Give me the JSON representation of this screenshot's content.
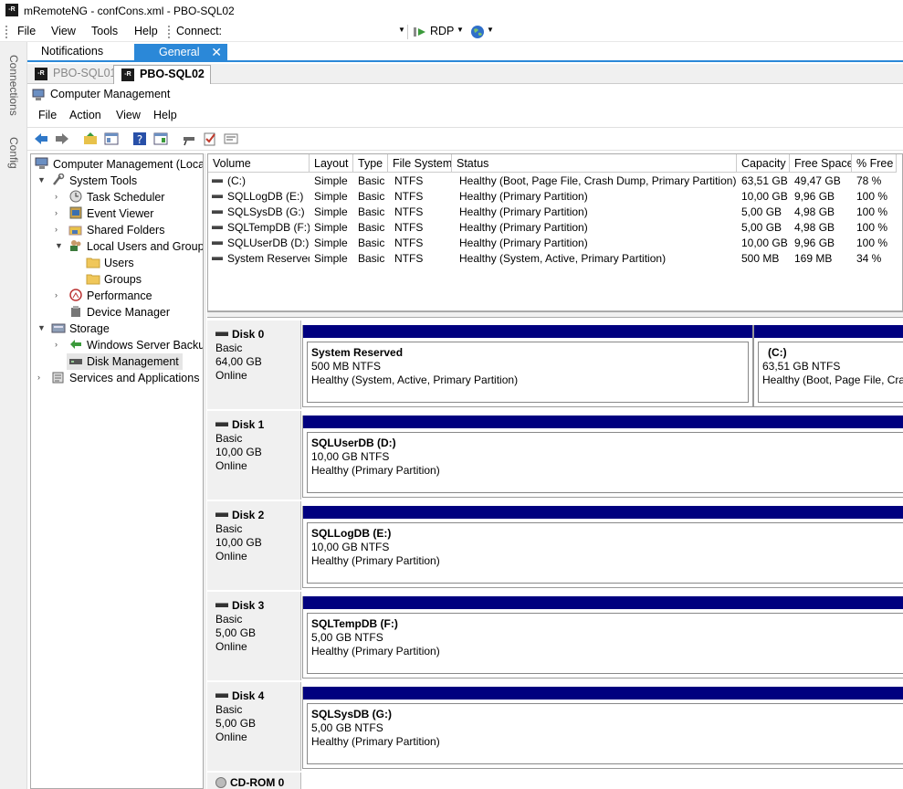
{
  "app": {
    "title": "mRemoteNG - confCons.xml - PBO-SQL02",
    "icon_text": "-R"
  },
  "main_menu": [
    "File",
    "View",
    "Tools",
    "Help"
  ],
  "connect": {
    "label": "Connect:",
    "value": "",
    "protocol": "RDP"
  },
  "side_tabs": [
    "Connections",
    "Config"
  ],
  "panel_tabs": [
    {
      "label": "Notifications"
    },
    {
      "label": "General",
      "active": true
    }
  ],
  "session_tabs": [
    {
      "label": "PBO-SQL01",
      "active": false
    },
    {
      "label": "PBO-SQL02",
      "active": true
    }
  ],
  "mmc": {
    "title": "Computer Management",
    "menu": [
      "File",
      "Action",
      "View",
      "Help"
    ]
  },
  "tree": [
    {
      "label": "Computer Management (Local",
      "icon": "computer-management-icon"
    },
    {
      "label": "System Tools",
      "icon": "tools-icon"
    },
    {
      "label": "Task Scheduler",
      "icon": "clock-icon"
    },
    {
      "label": "Event Viewer",
      "icon": "event-viewer-icon"
    },
    {
      "label": "Shared Folders",
      "icon": "shared-folder-icon"
    },
    {
      "label": "Local Users and Groups",
      "icon": "users-icon"
    },
    {
      "label": "Users",
      "icon": "folder-icon"
    },
    {
      "label": "Groups",
      "icon": "folder-icon"
    },
    {
      "label": "Performance",
      "icon": "performance-icon"
    },
    {
      "label": "Device Manager",
      "icon": "device-manager-icon"
    },
    {
      "label": "Storage",
      "icon": "storage-icon"
    },
    {
      "label": "Windows Server Backup",
      "icon": "backup-icon"
    },
    {
      "label": "Disk Management",
      "icon": "disk-management-icon",
      "selected": true
    },
    {
      "label": "Services and Applications",
      "icon": "services-icon"
    }
  ],
  "volume_table": {
    "columns": [
      "Volume",
      "Layout",
      "Type",
      "File System",
      "Status",
      "Capacity",
      "Free Space",
      "% Free"
    ],
    "rows": [
      [
        "(C:)",
        "Simple",
        "Basic",
        "NTFS",
        "Healthy (Boot, Page File, Crash Dump, Primary Partition)",
        "63,51 GB",
        "49,47 GB",
        "78 %"
      ],
      [
        "SQLLogDB (E:)",
        "Simple",
        "Basic",
        "NTFS",
        "Healthy (Primary Partition)",
        "10,00 GB",
        "9,96 GB",
        "100 %"
      ],
      [
        "SQLSysDB (G:)",
        "Simple",
        "Basic",
        "NTFS",
        "Healthy (Primary Partition)",
        "5,00 GB",
        "4,98 GB",
        "100 %"
      ],
      [
        "SQLTempDB (F:)",
        "Simple",
        "Basic",
        "NTFS",
        "Healthy (Primary Partition)",
        "5,00 GB",
        "4,98 GB",
        "100 %"
      ],
      [
        "SQLUserDB (D:)",
        "Simple",
        "Basic",
        "NTFS",
        "Healthy (Primary Partition)",
        "10,00 GB",
        "9,96 GB",
        "100 %"
      ],
      [
        "System Reserved",
        "Simple",
        "Basic",
        "NTFS",
        "Healthy (System, Active, Primary Partition)",
        "500 MB",
        "169 MB",
        "34 %"
      ]
    ]
  },
  "disks": [
    {
      "name": "Disk 0",
      "type": "Basic",
      "size": "64,00 GB",
      "status": "Online",
      "partitions": [
        {
          "name": "System Reserved",
          "size": "500 MB NTFS",
          "status": "Healthy (System, Active, Primary Partition)"
        },
        {
          "name": "(C:)",
          "size": "63,51 GB NTFS",
          "status": "Healthy (Boot, Page File, Crash"
        }
      ]
    },
    {
      "name": "Disk 1",
      "type": "Basic",
      "size": "10,00 GB",
      "status": "Online",
      "partitions": [
        {
          "name": "SQLUserDB  (D:)",
          "size": "10,00 GB NTFS",
          "status": "Healthy (Primary Partition)"
        }
      ]
    },
    {
      "name": "Disk 2",
      "type": "Basic",
      "size": "10,00 GB",
      "status": "Online",
      "partitions": [
        {
          "name": "SQLLogDB  (E:)",
          "size": "10,00 GB NTFS",
          "status": "Healthy (Primary Partition)"
        }
      ]
    },
    {
      "name": "Disk 3",
      "type": "Basic",
      "size": "5,00 GB",
      "status": "Online",
      "partitions": [
        {
          "name": "SQLTempDB  (F:)",
          "size": "5,00 GB NTFS",
          "status": "Healthy (Primary Partition)"
        }
      ]
    },
    {
      "name": "Disk 4",
      "type": "Basic",
      "size": "5,00 GB",
      "status": "Online",
      "partitions": [
        {
          "name": "SQLSysDB  (G:)",
          "size": "5,00 GB NTFS",
          "status": "Healthy (Primary Partition)"
        }
      ]
    },
    {
      "name": "CD-ROM 0"
    }
  ],
  "colors": {
    "accent": "#2b88d8",
    "partition_bar": "#00007f",
    "selection": "#cce8ff"
  }
}
